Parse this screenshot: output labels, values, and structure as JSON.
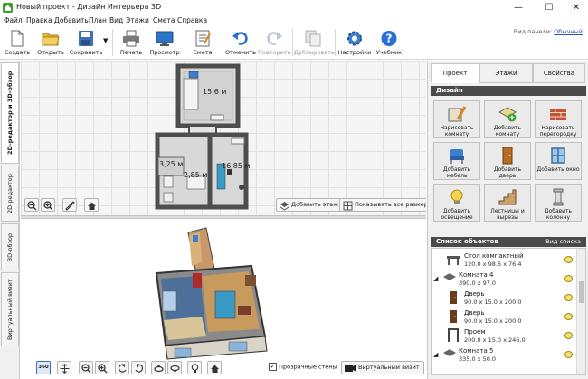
{
  "window": {
    "title": "Новый проект - Дизайн Интерьера 3D",
    "minimize": "—",
    "maximize": "☐",
    "close": "✕"
  },
  "menu": [
    "Файл",
    "Правка",
    "Добавить",
    "План",
    "Вид",
    "Этажи",
    "Смета",
    "Справка"
  ],
  "toolbar": {
    "create": "Создать",
    "open": "Открыть",
    "save": "Сохранить",
    "print": "Печать",
    "preview": "Просмотр",
    "estimate": "Смета",
    "undo": "Отменить",
    "redo": "Повторить",
    "duplicate": "Дублировать",
    "settings": "Настройки",
    "tutorial": "Учебник",
    "panel_view_label": "Вид панели:",
    "panel_view_value": "Обычный"
  },
  "left_tabs": [
    "2D-редактор и 3D-обзор",
    "2D-редактор",
    "3D-обзор",
    "Виртуальный визит"
  ],
  "plan": {
    "room_labels": [
      "15,6 м",
      "3,25 м",
      "16,85 м",
      "2,85 м"
    ]
  },
  "plan_buttons": {
    "add_floor": "Добавить этаж",
    "show_sizes": "Показывать все размеры"
  },
  "view3d_controls": {
    "transparent_walls": "Прозрачные стены",
    "transparent_checked": true,
    "virtual_visit": "Виртуальный визит",
    "rotate_label": "360"
  },
  "right_tabs": [
    "Проект",
    "Этажи",
    "Свойства"
  ],
  "design": {
    "header": "Дизайн",
    "buttons": [
      {
        "label": "Нарисовать комнату",
        "icon": "draw-room-icon"
      },
      {
        "label": "Добавить комнату",
        "icon": "add-room-icon"
      },
      {
        "label": "Нарисовать перегородку",
        "icon": "draw-partition-icon"
      },
      {
        "label": "Добавить мебель",
        "icon": "add-furniture-icon"
      },
      {
        "label": "Добавить дверь",
        "icon": "add-door-icon"
      },
      {
        "label": "Добавить окно",
        "icon": "add-window-icon"
      },
      {
        "label": "Добавить освещение",
        "icon": "add-lighting-icon"
      },
      {
        "label": "Лестницы и вырезы",
        "icon": "stairs-icon"
      },
      {
        "label": "Добавить колонну",
        "icon": "add-column-icon"
      }
    ]
  },
  "objects": {
    "header": "Список объектов",
    "view_link": "Вид списка",
    "items": [
      {
        "name": "Стол компактный",
        "dims": "120.0 x 98.6 x 76.4",
        "level": 1
      },
      {
        "name": "Комната 4",
        "dims": "390.0 x 97.0",
        "level": 0
      },
      {
        "name": "Дверь",
        "dims": "90.0 x 15.0 x 200.0",
        "level": 1
      },
      {
        "name": "Дверь",
        "dims": "90.0 x 15.0 x 200.0",
        "level": 1
      },
      {
        "name": "Проем",
        "dims": "200.0 x 15.0 x 246.0",
        "level": 1
      },
      {
        "name": "Комната 5",
        "dims": "335.0 x 50.0",
        "level": 0
      }
    ]
  },
  "colors": {
    "accent": "#2a6fd6",
    "header_dark": "#4a4a4a",
    "wall": "#555555",
    "floor_wood": "#c89a5e"
  }
}
